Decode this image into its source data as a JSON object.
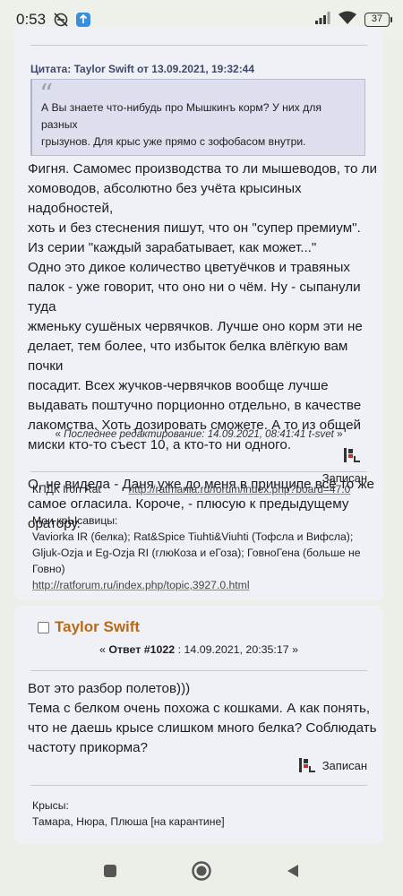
{
  "status_bar": {
    "time": "0:53",
    "battery": "37"
  },
  "post1": {
    "quote_header": "Цитата: Taylor Swift от 13.09.2021, 19:32:44",
    "quote_lines": [
      "А Вы знаете что-нибудь про Мышкинъ корм? У них для разных",
      "грызунов. Для крыс уже прямо с зофобасом внутри."
    ],
    "body_lines": [
      "Фигня. Самомес производства то ли мышеводов, то ли",
      "хомоводов, абсолютно без учёта крысиных надобностей,",
      "хоть и без стеснения пишут, что он \"супер премиум\".",
      "Из серии \"каждый зарабатывает, как может...\"",
      "Одно это дикое количество цветуёчков и травяных",
      "палок - уже говорит, что оно ни о чём. Ну - сыпанули туда",
      "жменьку сушёных червячков. Лучше оно корм эти не",
      "делает, тем более, что избыток белка влёгкую вам почки",
      "посадит. Всех жучков-червячков вообще лучше",
      "выдавать поштучно порционно отдельно, в качестве",
      "лакомства. Хоть дозировать сможете. А то из общей",
      "миски кто-то съест 10, а кто-то ни одного.",
      "",
      "О, не видела - Даня уже до меня в принципе всё то же",
      "самое огласила. Короче, - плюсую к предыдущему",
      "оратору."
    ],
    "modified_prefix": "« ",
    "modified_text": "Последнее редактирование: 14.09.2021, 08:41:41 t-svet",
    "modified_suffix": " »",
    "logged_label": "Записан",
    "sig_club_label": "КПДК Iron Rat",
    "sig_club_url": "http://ratmania.ru/forum/index.php?board=47.0",
    "sig_rats_title": "Мои крЫсавицы:",
    "sig_rats_lines": [
      "Vaviorka IR (белка); Rat&Spice Tiuhti&Viuhti (Тофсла и Вифсла);",
      "Gljuk-Ozja и Eg-Ozja RI (глюКоза и еГоза); ГовноГена (больше не",
      "Говно)"
    ],
    "sig_rats_url": "http://ratforum.ru/index.php/topic,3927.0.html"
  },
  "post2": {
    "author": "Taylor Swift",
    "reply_prefix": "« ",
    "reply_label": "Ответ #1022",
    "reply_date": " : 14.09.2021, 20:35:17 »",
    "body_lines": [
      "Вот это разбор полетов)))",
      "Тема с белком очень похожа с кошками. А как понять,",
      "что не даешь крысе слишком много белка? Соблюдать",
      "частоту прикорма?"
    ],
    "logged_label": "Записан",
    "sig_title": "Крысы:",
    "sig_text": "Тамара, Нюра, Плюша [на карантине]"
  },
  "colors": {
    "author": "#b96a16",
    "card_bg": "#f0f1f6",
    "quote_bg": "#dedfef"
  }
}
